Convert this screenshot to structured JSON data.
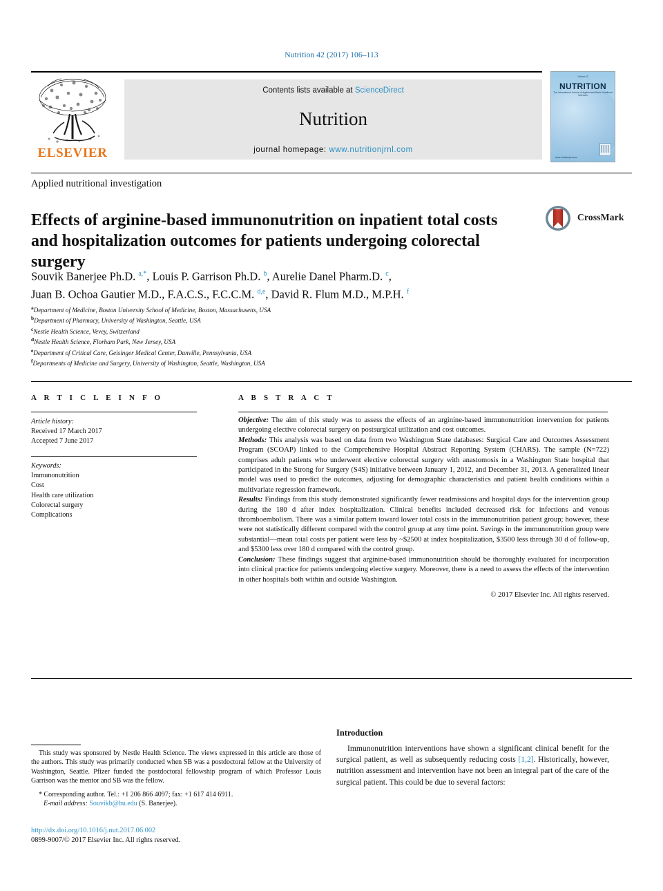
{
  "running_head": "Nutrition 42 (2017) 106–113",
  "masthead": {
    "publisher": "ELSEVIER",
    "contents_prefix": "Contents lists available at ",
    "sciencedirect": "ScienceDirect",
    "journal_title": "Nutrition",
    "homepage_prefix": "journal homepage: ",
    "homepage_url": "www.nutritionjrnl.com",
    "cover": {
      "title": "NUTRITION",
      "subtitle": "The International Journal of Applied and Basic Nutritional Sciences",
      "top_line": "Volume 42",
      "bottom_line": "www.nutritionjrnl.com"
    }
  },
  "section_kind": "Applied nutritional investigation",
  "title": "Effects of arginine-based immunonutrition on inpatient total costs and hospitalization outcomes for patients undergoing colorectal surgery",
  "crossmark_label": "CrossMark",
  "authors_line_1": "Souvik Banerjee Ph.D. <sup>a,*</sup>, Louis P. Garrison Ph.D. <sup>b</sup>, Aurelie Danel Pharm.D. <sup>c</sup>,",
  "authors_line_2": "Juan B. Ochoa Gautier M.D., F.A.C.S., F.C.C.M. <sup>d,e</sup>, David R. Flum M.D., M.P.H. <sup>f</sup>",
  "affiliations": [
    {
      "marker": "a",
      "text": "Department of Medicine, Boston University School of Medicine, Boston, Massachusetts, USA"
    },
    {
      "marker": "b",
      "text": "Department of Pharmacy, University of Washington, Seattle, USA"
    },
    {
      "marker": "c",
      "text": "Nestle Health Science, Vevey, Switzerland"
    },
    {
      "marker": "d",
      "text": "Nestle Health Science, Florham Park, New Jersey, USA"
    },
    {
      "marker": "e",
      "text": "Department of Critical Care, Geisinger Medical Center, Danville, Pennsylvania, USA"
    },
    {
      "marker": "f",
      "text": "Departments of Medicine and Surgery, University of Washington, Seattle, Washington, USA"
    }
  ],
  "article_info": {
    "heading": "A R T I C L E  I N F O",
    "history_label": "Article history:",
    "received": "Received 17 March 2017",
    "accepted": "Accepted 7 June 2017",
    "keywords_label": "Keywords:",
    "keywords": [
      "Immunonutrition",
      "Cost",
      "Health care utilization",
      "Colorectal surgery",
      "Complications"
    ]
  },
  "abstract": {
    "heading": "A B S T R A C T",
    "objective_label": "Objective:",
    "objective_text": " The aim of this study was to assess the effects of an arginine-based immunonutrition intervention for patients undergoing elective colorectal surgery on postsurgical utilization and cost outcomes.",
    "methods_label": "Methods:",
    "methods_text": " This analysis was based on data from two Washington State databases: Surgical Care and Outcomes Assessment Program (SCOAP) linked to the Comprehensive Hospital Abstract Reporting System (CHARS). The sample (N=722) comprises adult patients who underwent elective colorectal surgery with anastomosis in a Washington State hospital that participated in the Strong for Surgery (S4S) initiative between January 1, 2012, and December 31, 2013. A generalized linear model was used to predict the outcomes, adjusting for demographic characteristics and patient health conditions within a multivariate regression framework.",
    "results_label": "Results:",
    "results_text": " Findings from this study demonstrated significantly fewer readmissions and hospital days for the intervention group during the 180 d after index hospitalization. Clinical benefits included decreased risk for infections and venous thromboembolism. There was a similar pattern toward lower total costs in the immunonutrition patient group; however, these were not statistically different compared with the control group at any time point. Savings in the immunonutrition group were substantial—mean total costs per patient were less by ~$2500 at index hospitalization, $3500 less through 30 d of follow-up, and $5300 less over 180 d compared with the control group.",
    "conclusion_label": "Conclusion:",
    "conclusion_text": " These findings suggest that arginine-based immunonutrition should be thoroughly evaluated for incorporation into clinical practice for patients undergoing elective surgery. Moreover, there is a need to assess the effects of the intervention in other hospitals both within and outside Washington.",
    "copyright": "© 2017 Elsevier Inc. All rights reserved."
  },
  "footnotes": {
    "funding": "This study was sponsored by Nestle Health Science. The views expressed in this article are those of the authors. This study was primarily conducted when SB was a postdoctoral fellow at the University of Washington, Seattle. Pfizer funded the postdoctoral fellowship program of which Professor Louis Garrison was the mentor and SB was the fellow.",
    "corresponding": "* Corresponding author. Tel.: +1 206 866 4097; fax: +1 617 414 6911.",
    "email_label": "E-mail address:",
    "email": "Souvikb@bu.edu",
    "email_suffix": " (S. Banerjee).",
    "doi": "http://dx.doi.org/10.1016/j.nut.2017.06.002",
    "issn_line": "0899-9007/© 2017 Elsevier Inc. All rights reserved."
  },
  "introduction": {
    "heading": "Introduction",
    "paragraph_part1": "Immunonutrition interventions have shown a significant clinical benefit for the surgical patient, as well as subsequently reducing costs ",
    "citation": "[1,2]",
    "paragraph_part2": ". Historically, however, nutrition assessment and intervention have not been an integral part of the care of the surgical patient. This could be due to several factors:"
  },
  "colors": {
    "link": "#2b8fc4",
    "elsevier_orange": "#e8761b",
    "banner_gray": "#e6e6e6"
  }
}
